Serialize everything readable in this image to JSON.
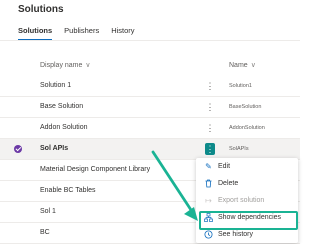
{
  "page_title": "Solutions",
  "tabs": [
    {
      "label": "Solutions",
      "active": true
    },
    {
      "label": "Publishers",
      "active": false
    },
    {
      "label": "History",
      "active": false
    }
  ],
  "table": {
    "columns": [
      "Display name",
      "Name"
    ],
    "rows": [
      {
        "display": "Solution 1",
        "name": "Solution1"
      },
      {
        "display": "Base Solution",
        "name": "BaseSolution"
      },
      {
        "display": "Addon Solution",
        "name": "AddonSolution"
      },
      {
        "display": "Sol APIs",
        "name": "SolAPIs",
        "selected": true
      },
      {
        "display": "Material Design Component Library",
        "name": ""
      },
      {
        "display": "Enable BC Tables",
        "name": ""
      },
      {
        "display": "Sol 1",
        "name": ""
      },
      {
        "display": "BC",
        "name": ""
      }
    ]
  },
  "context_menu": {
    "items": [
      {
        "label": "Edit",
        "icon": "pencil-icon",
        "disabled": false
      },
      {
        "label": "Delete",
        "icon": "trash-icon",
        "disabled": false
      },
      {
        "label": "Export solution",
        "icon": "export-icon",
        "disabled": true
      },
      {
        "label": "Show dependencies",
        "icon": "dependencies-icon",
        "disabled": false,
        "highlighted": true
      },
      {
        "label": "See history",
        "icon": "history-icon",
        "disabled": false
      }
    ]
  },
  "colors": {
    "accent": "#0f6cbd",
    "highlight_arrow": "#1ab394",
    "selected_row_marker": "#6c3aa6"
  }
}
